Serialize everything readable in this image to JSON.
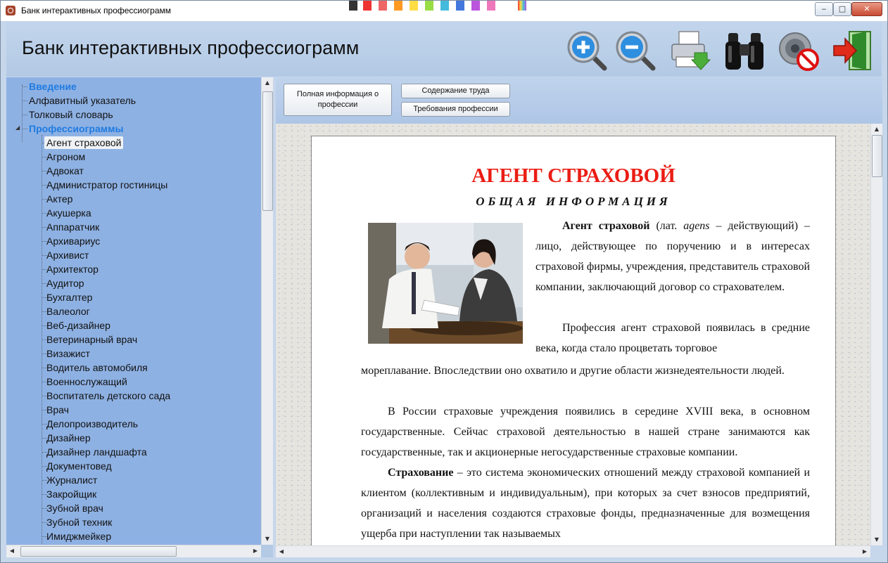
{
  "window": {
    "title": "Банк интерактивных профессиограмм",
    "controls": {
      "minimize": "‒",
      "maximize": "□",
      "close": "✕"
    }
  },
  "header": {
    "app_title": "Банк интерактивных профессиограмм",
    "tools": [
      {
        "name": "zoom-in-icon"
      },
      {
        "name": "zoom-out-icon"
      },
      {
        "name": "print-icon"
      },
      {
        "name": "search-binoculars-icon"
      },
      {
        "name": "sound-off-icon"
      },
      {
        "name": "exit-icon"
      }
    ]
  },
  "sidebar": {
    "top_items": [
      {
        "label": "Введение",
        "type": "category"
      },
      {
        "label": "Алфавитный указатель",
        "type": "item"
      },
      {
        "label": "Толковый словарь",
        "type": "item"
      },
      {
        "label": "Профессиограммы",
        "type": "category"
      }
    ],
    "professions": [
      "Агент страховой",
      "Агроном",
      "Адвокат",
      "Администратор гостиницы",
      "Актер",
      "Акушерка",
      "Аппаратчик",
      "Архивариус",
      "Архивист",
      "Архитектор",
      "Аудитор",
      "Бухгалтер",
      "Валеолог",
      "Веб-дизайнер",
      "Ветеринарный врач",
      "Визажист",
      "Водитель автомобиля",
      "Военнослужащий",
      "Воспитатель детского сада",
      "Врач",
      "Делопроизводитель",
      "Дизайнер",
      "Дизайнер ландшафта",
      "Документовед",
      "Журналист",
      "Закройщик",
      "Зубной врач",
      "Зубной техник",
      "Имиджмейкер"
    ],
    "selected": "Агент страховой"
  },
  "tabs": {
    "full_info": "Полная информация о профессии",
    "work_content": "Содержание труда",
    "requirements": "Требования профессии"
  },
  "document": {
    "title": "АГЕНТ СТРАХОВОЙ",
    "subtitle": "ОБЩАЯ ИНФОРМАЦИЯ",
    "p1_term": "Агент страховой",
    "p1_open": " (лат. ",
    "p1_agens": "agens",
    "p1_rest": " – действующий) – лицо, действующее по поручению и в интересах страховой фирмы, учреждения, представитель страховой компании, заключающий договор со страхователем.",
    "p2_part1": "Профессия агент страховой появилась в средние века, когда стало процветать торговое",
    "p2_part2": "мореплавание. Впоследствии оно охватило и другие области жизнедеятельности людей.",
    "p3": "В России страховые учреждения появились в середине XVIII века, в основном государственные. Сейчас страховой деятельностью в нашей стране занимаются как государственные, так и акционерные негосударственные страховые компании.",
    "p4_term": "Страхование",
    "p4_rest": " – это система экономических отношений между страховой компанией и клиентом (коллективным и индивидуальным), при которых за счет взносов предприятий, организаций и населения создаются страховые фонды, предназначенные для возмещения ущерба при наступлении так называемых"
  },
  "colors": {
    "category": "#1f7be0",
    "tree_bg": "#8eb1e3",
    "doc_title": "#ea1d14"
  }
}
